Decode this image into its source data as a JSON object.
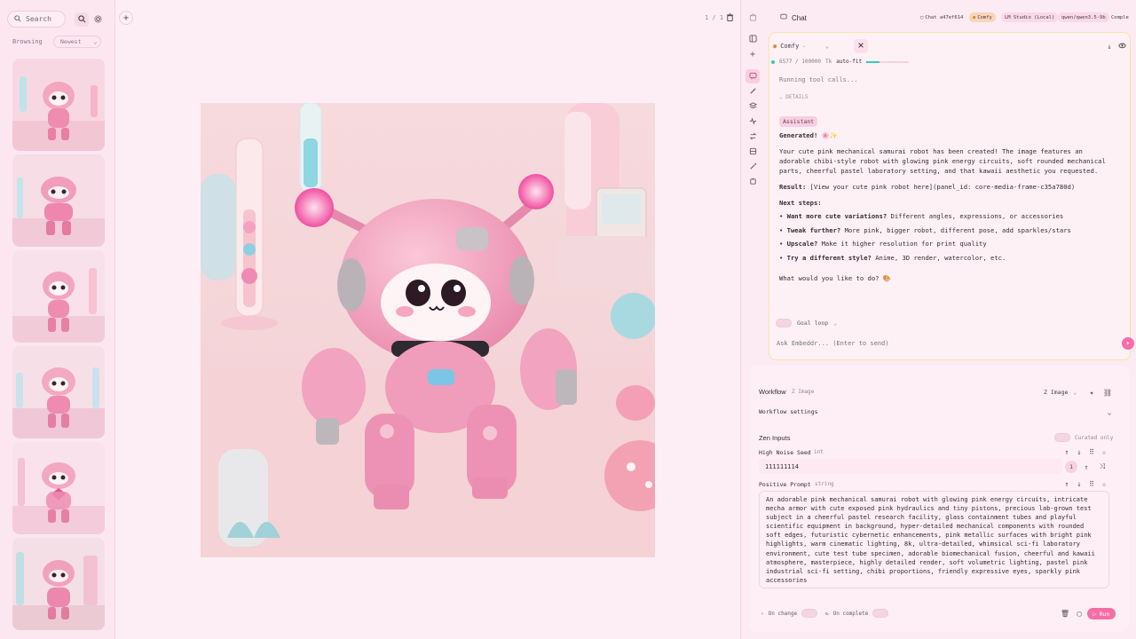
{
  "gallery": {
    "search_placeholder": "Search",
    "browsing_label": "Browsing",
    "sort_value": "Newest",
    "thumbnail_count": 6
  },
  "canvas": {
    "page_counter": "1 / 1"
  },
  "chat": {
    "title": "Chat",
    "chips": [
      {
        "label": "Chat a47ef614"
      },
      {
        "label": "Comfy"
      },
      {
        "label": "LM Studio (Local)"
      },
      {
        "label": "qwen/qwen3.5-9b"
      },
      {
        "label": "Comple"
      }
    ],
    "model_select": "Comfy",
    "context_used": "6577 / 100000",
    "context_unit": "Tk",
    "fit_label": "auto-fit",
    "context_fraction": 0.066,
    "running_text": "Running tool calls...",
    "details_label": "DETAILS",
    "assistant_badge": "Assistant",
    "generated_heading": "Generated!",
    "generated_emoji": "🌸✨",
    "intro_paragraph": "Your cute pink mechanical samurai robot has been created! The image features an adorable chibi-style robot with glowing pink energy circuits, soft rounded mechanical parts, cheerful pastel laboratory setting, and that kawaii aesthetic you requested.",
    "result_label": "Result:",
    "result_text": "[View your cute pink robot here](panel_id: core-media-frame-c35a780d)",
    "next_steps_label": "Next steps:",
    "steps": [
      {
        "label": "Want more cute variations?",
        "text": "Different angles, expressions, or accessories"
      },
      {
        "label": "Tweak further?",
        "text": "More pink, bigger robot, different pose, add sparkles/stars"
      },
      {
        "label": "Upscale?",
        "text": "Make it higher resolution for print quality"
      },
      {
        "label": "Try a different style?",
        "text": "Anime, 3D render, watercolor, etc."
      }
    ],
    "closing_question": "What would you like to do? 🎨",
    "goal_loop_label": "Goal loop",
    "input_placeholder": "Ask Embeddr... (Enter to send)"
  },
  "workflow": {
    "title": "Workflow",
    "type": "Z Image",
    "type_select": "Z Image",
    "settings_label": "Workflow settings",
    "zen_inputs_label": "Zen Inputs",
    "curated_label": "Curated only",
    "seed_label": "High Noise Seed",
    "seed_type": "int",
    "seed_value": "111111114",
    "seed_step": "1",
    "prompt_label": "Positive Prompt",
    "prompt_type": "string",
    "prompt_value": "An adorable pink mechanical samurai robot with glowing pink energy circuits, intricate mecha armor with cute exposed pink hydraulics and tiny pistons, precious lab-grown test subject in a cheerful pastel research facility, glass containment tubes and playful scientific equipment in background, hyper-detailed mechanical components with rounded soft edges, futuristic cybernetic enhancements, pink metallic surfaces with bright pink highlights, warm cinematic lighting, 8k, ultra-detailed, whimsical sci-fi laboratory environment, cute test tube specimen, adorable biomechanical fusion, cheerful and kawaii atmosphere, masterpiece, highly detailed render, soft volumetric lighting, pastel pink industrial sci-fi setting, chibi proportions, friendly expressive eyes, sparkly pink accessories",
    "on_change_label": "On change",
    "on_complete_label": "On complete",
    "run_label": "Run"
  },
  "colors": {
    "background": "#fbe6f0",
    "accent": "#f66ea6",
    "progress": "#3fc7b3",
    "card_border": "#f6e5a9"
  }
}
